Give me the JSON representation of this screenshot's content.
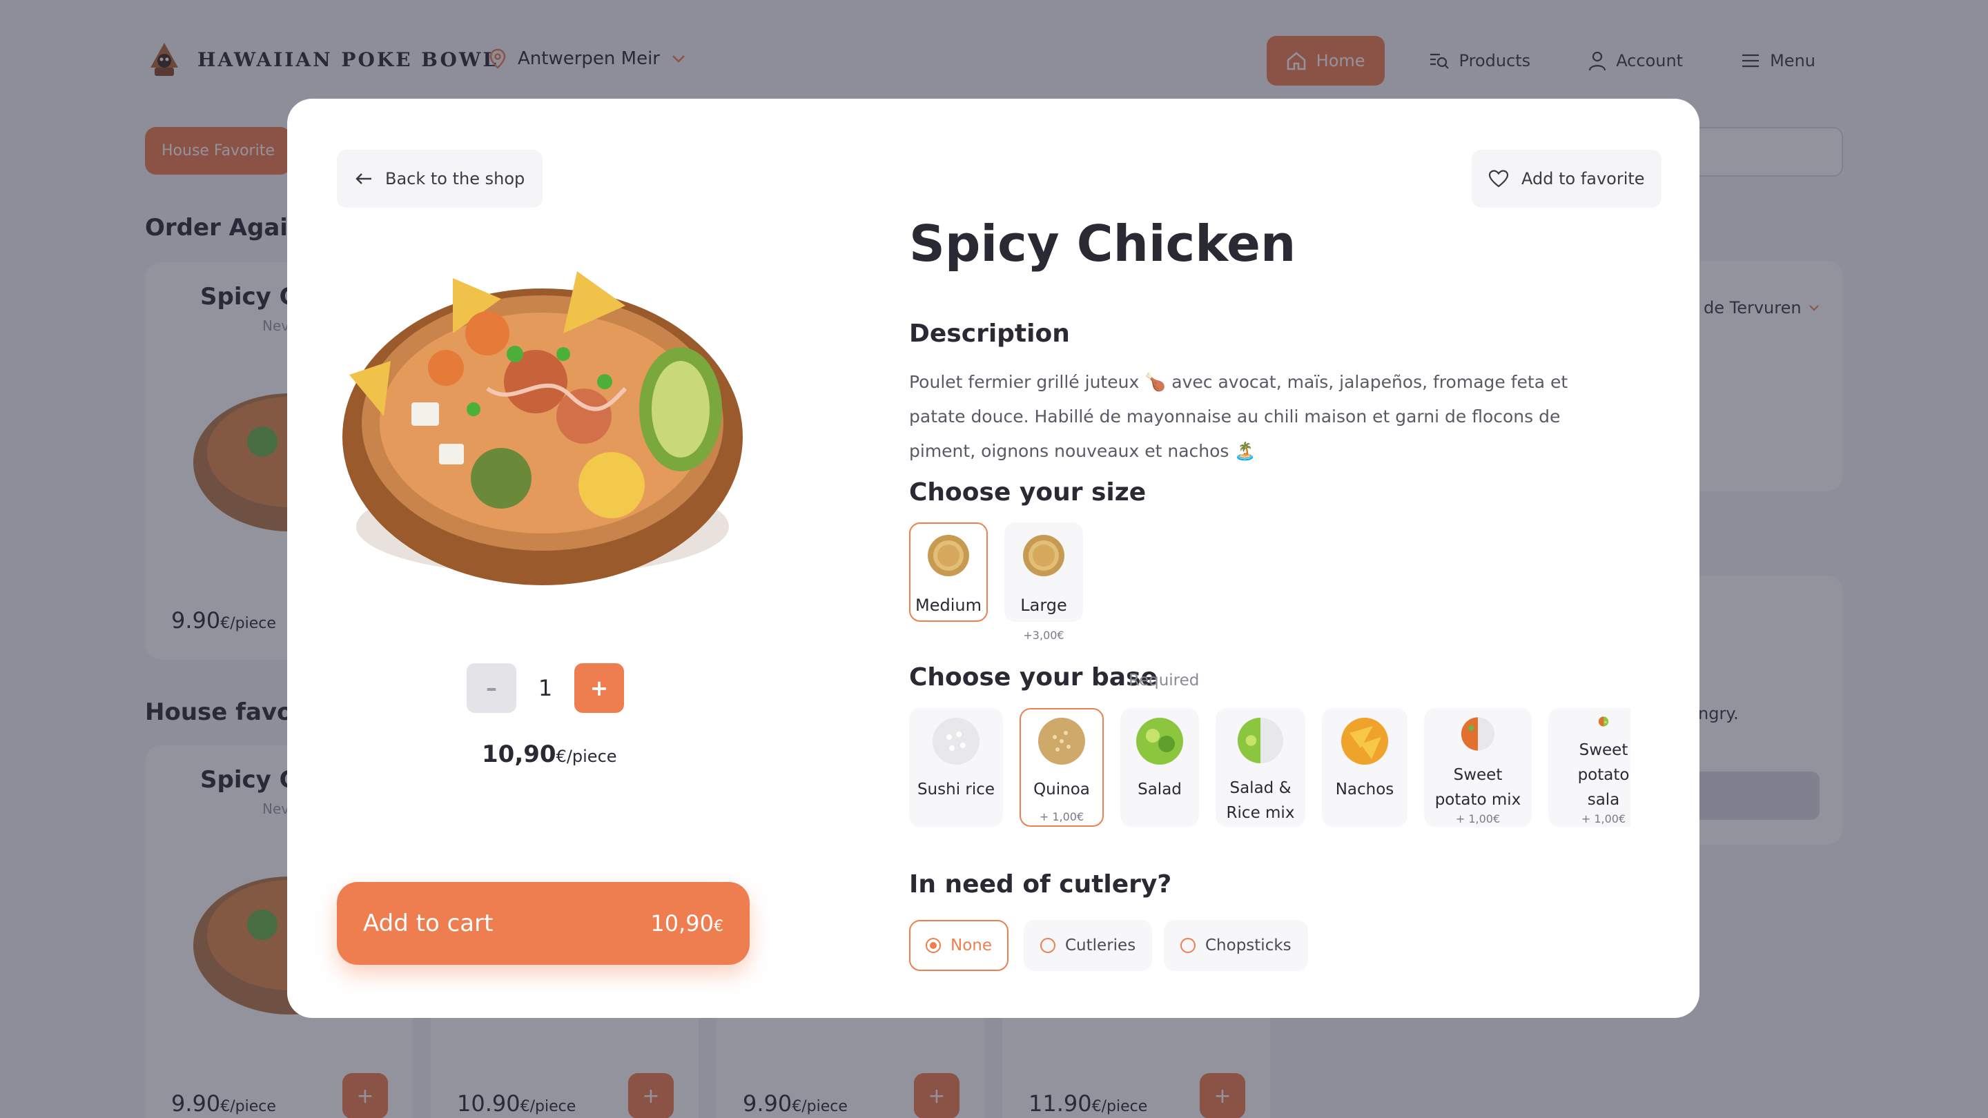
{
  "brand": {
    "name": "HAWAIIAN POKE BOWL"
  },
  "location": {
    "name": "Antwerpen Meir"
  },
  "nav": [
    {
      "label": "Home",
      "icon": "home-icon"
    },
    {
      "label": "Products",
      "icon": "products-search-icon"
    },
    {
      "label": "Account",
      "icon": "user-icon"
    },
    {
      "label": "Menu",
      "icon": "hamburger-icon"
    }
  ],
  "background": {
    "chip": "House Favorite",
    "section_order_again": "Order Again",
    "section_house_favorites": "House favori",
    "cards_top": [
      {
        "name": "Spicy Cl",
        "sub": "Nev",
        "price": "9.90",
        "unit": "€/piece"
      }
    ],
    "cards_bottom": [
      {
        "name": "Spicy Cl",
        "sub": "Nev",
        "price": "9.90",
        "unit": "€/piece"
      },
      {
        "price": "10.90",
        "unit": "€/piece"
      },
      {
        "price": "9.90",
        "unit": "€/piece"
      },
      {
        "price": "11.90",
        "unit": "€/piece"
      }
    ],
    "right_store": "de Tervuren",
    "right_text": "ngry.",
    "add_symbol": "+"
  },
  "modal": {
    "back_label": "Back to the shop",
    "favorite_label": "Add to favorite",
    "title": "Spicy Chicken",
    "description_heading": "Description",
    "description": "Poulet fermier grillé juteux 🍗 avec avocat, maïs, jalapeños, fromage feta et patate douce. Habillé de mayonnaise au chili maison et garni de flocons de piment, oignons nouveaux et nachos 🏝️",
    "quantity": "1",
    "minus": "–",
    "plus": "+",
    "unit_price": "10,90",
    "unit_suffix": "€/piece",
    "size_heading": "Choose your size",
    "sizes": [
      {
        "label": "Medium",
        "selected": true,
        "extra": ""
      },
      {
        "label": "Large",
        "selected": false,
        "extra": "+3,00€"
      }
    ],
    "base_heading": "Choose your base",
    "base_required": "Required",
    "bases": [
      {
        "label": "Sushi rice",
        "selected": false,
        "extra": ""
      },
      {
        "label": "Quinoa",
        "selected": true,
        "extra": "+ 1,00€"
      },
      {
        "label": "Salad",
        "selected": false,
        "extra": ""
      },
      {
        "label": "Salad & Rice mix",
        "selected": false,
        "extra": ""
      },
      {
        "label": "Nachos",
        "selected": false,
        "extra": ""
      },
      {
        "label": "Sweet potato mix",
        "selected": false,
        "extra": "+ 1,00€"
      },
      {
        "label": "Sweet potato sala",
        "selected": false,
        "extra": "+ 1,00€"
      }
    ],
    "cutlery_heading": "In need of cutlery?",
    "cutlery": [
      {
        "label": "None",
        "selected": true
      },
      {
        "label": "Cutleries",
        "selected": false
      },
      {
        "label": "Chopsticks",
        "selected": false
      }
    ],
    "cart_label": "Add to cart",
    "cart_total": "10,90",
    "cart_currency": "€"
  },
  "colors": {
    "accent": "#ee7e4f",
    "text": "#2a2a35",
    "muted": "#8a8a95"
  }
}
